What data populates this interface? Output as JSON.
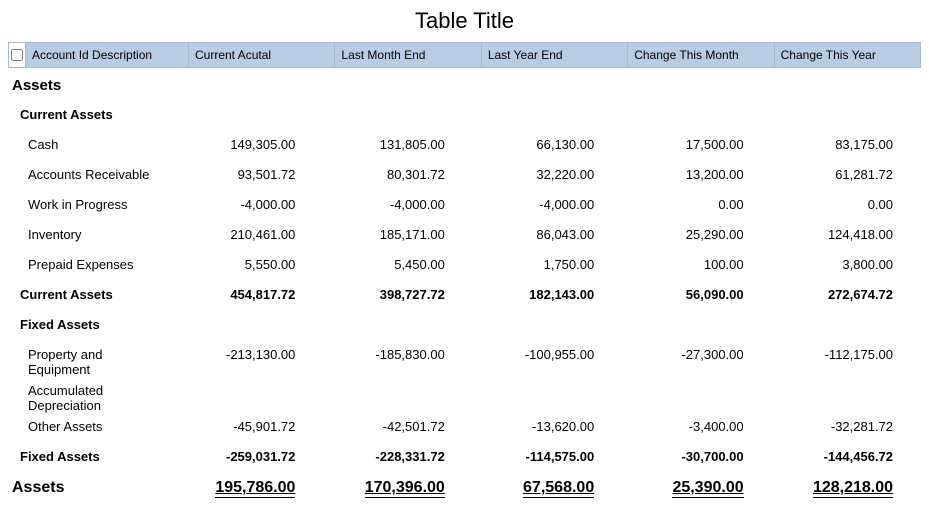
{
  "title": "Table Title",
  "columns": [
    "Account Id Description",
    "Current Acutal",
    "Last Month End",
    "Last Year End",
    "Change This Month",
    "Change This Year"
  ],
  "sections": {
    "assets_label": "Assets",
    "current_assets": {
      "label": "Current Assets",
      "rows": [
        {
          "label": "Cash",
          "v": [
            "149,305.00",
            "131,805.00",
            "66,130.00",
            "17,500.00",
            "83,175.00"
          ]
        },
        {
          "label": "Accounts Receivable",
          "v": [
            "93,501.72",
            "80,301.72",
            "32,220.00",
            "13,200.00",
            "61,281.72"
          ]
        },
        {
          "label": "Work in Progress",
          "v": [
            "-4,000.00",
            "-4,000.00",
            "-4,000.00",
            "0.00",
            "0.00"
          ]
        },
        {
          "label": "Inventory",
          "v": [
            "210,461.00",
            "185,171.00",
            "86,043.00",
            "25,290.00",
            "124,418.00"
          ]
        },
        {
          "label": "Prepaid Expenses",
          "v": [
            "5,550.00",
            "5,450.00",
            "1,750.00",
            "100.00",
            "3,800.00"
          ]
        }
      ],
      "subtotal": {
        "label": "Current Assets",
        "v": [
          "454,817.72",
          "398,727.72",
          "182,143.00",
          "56,090.00",
          "272,674.72"
        ]
      }
    },
    "fixed_assets": {
      "label": "Fixed Assets",
      "rows": [
        {
          "label": "Property and Equipment",
          "v": [
            "-213,130.00",
            "-185,830.00",
            "-100,955.00",
            "-27,300.00",
            "-112,175.00"
          ]
        },
        {
          "label": "Accumulated Depreciation",
          "v": [
            "",
            "",
            "",
            "",
            ""
          ]
        },
        {
          "label": "Other Assets",
          "v": [
            "-45,901.72",
            "-42,501.72",
            "-13,620.00",
            "-3,400.00",
            "-32,281.72"
          ]
        }
      ],
      "subtotal": {
        "label": "Fixed Assets",
        "v": [
          "-259,031.72",
          "-228,331.72",
          "-114,575.00",
          "-30,700.00",
          "-144,456.72"
        ]
      }
    },
    "grand_total": {
      "label": "Assets",
      "v": [
        "195,786.00",
        "170,396.00",
        "67,568.00",
        "25,390.00",
        "128,218.00"
      ]
    }
  }
}
